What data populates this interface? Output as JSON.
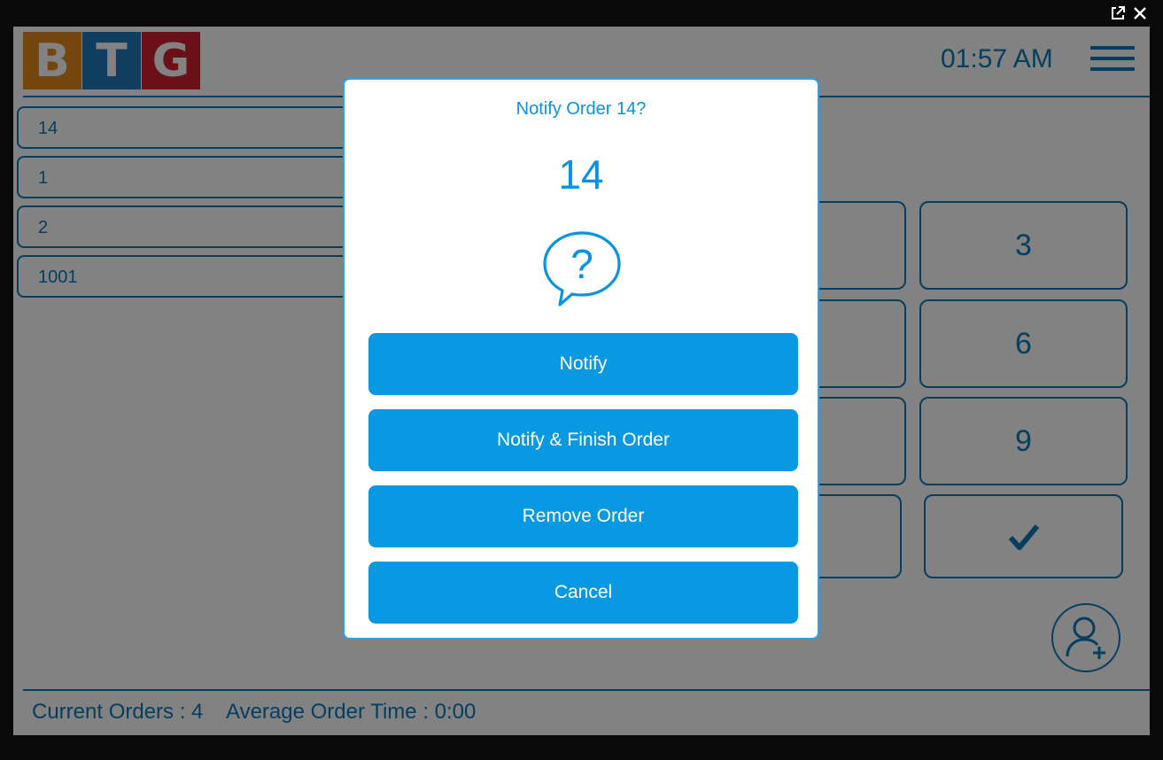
{
  "window": {
    "popout_icon": "external-link-icon",
    "close_icon": "close-icon"
  },
  "header": {
    "logo_letters": [
      "B",
      "T",
      "G"
    ],
    "logo_colors": [
      "#e38a1c",
      "#1f7bbf",
      "#d4202e"
    ],
    "clock": "01:57 AM",
    "menu_icon": "hamburger-menu-icon"
  },
  "orders": [
    "14",
    "1",
    "2",
    "1001"
  ],
  "keypad": {
    "visible_keys": [
      "3",
      "6",
      "9"
    ],
    "confirm_icon": "checkmark-icon"
  },
  "add_user_icon": "add-user-icon",
  "footer": {
    "current_orders": "Current Orders : 4",
    "average_time": "Average Order Time : 0:00"
  },
  "dialog": {
    "title": "Notify Order 14?",
    "order_number": "14",
    "icon": "question-bubble-icon",
    "buttons": {
      "notify": "Notify",
      "notify_finish": "Notify & Finish Order",
      "remove": "Remove Order",
      "cancel": "Cancel"
    }
  },
  "colors": {
    "accent": "#0a7ab8",
    "dialog_button": "#0999e3"
  }
}
